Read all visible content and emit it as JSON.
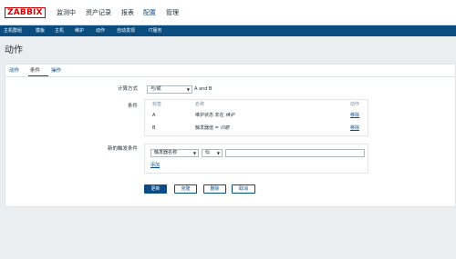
{
  "header": {
    "logo": "ZABBIX",
    "menu": [
      "监测中",
      "资产记录",
      "报表",
      "配置",
      "管理"
    ],
    "active_menu_index": 3
  },
  "submenu": [
    "主机群组",
    "模板",
    "主机",
    "维护",
    "动作",
    "自动发现",
    "IT服务"
  ],
  "page_title": "动作",
  "tabs": [
    "动作",
    "条件",
    "操作"
  ],
  "active_tab_index": 1,
  "form": {
    "calc_label": "计算方式",
    "calc_value": "与/或",
    "calc_expression": "A and B",
    "conditions_label": "条件",
    "conditions_headers": {
      "tag": "标签",
      "name": "名称",
      "action": "动作"
    },
    "conditions": [
      {
        "tag": "A",
        "name_prefix": "维护状态 非在",
        "name_value": "维护",
        "action": "移除"
      },
      {
        "tag": "B",
        "name_prefix": "触发器值 =",
        "name_value": "问题",
        "action": "移除"
      }
    ],
    "new_condition_label": "新的触发条件",
    "new_condition_type": "触发器名称",
    "new_condition_operator": "似",
    "new_condition_value": "",
    "add_link": "添加"
  },
  "buttons": {
    "update": "更新",
    "clone": "克隆",
    "delete": "删除",
    "cancel": "取消"
  },
  "colors": {
    "accent": "#0b4b85",
    "logo": "#d40000",
    "subbar": "#0b4d7e"
  }
}
